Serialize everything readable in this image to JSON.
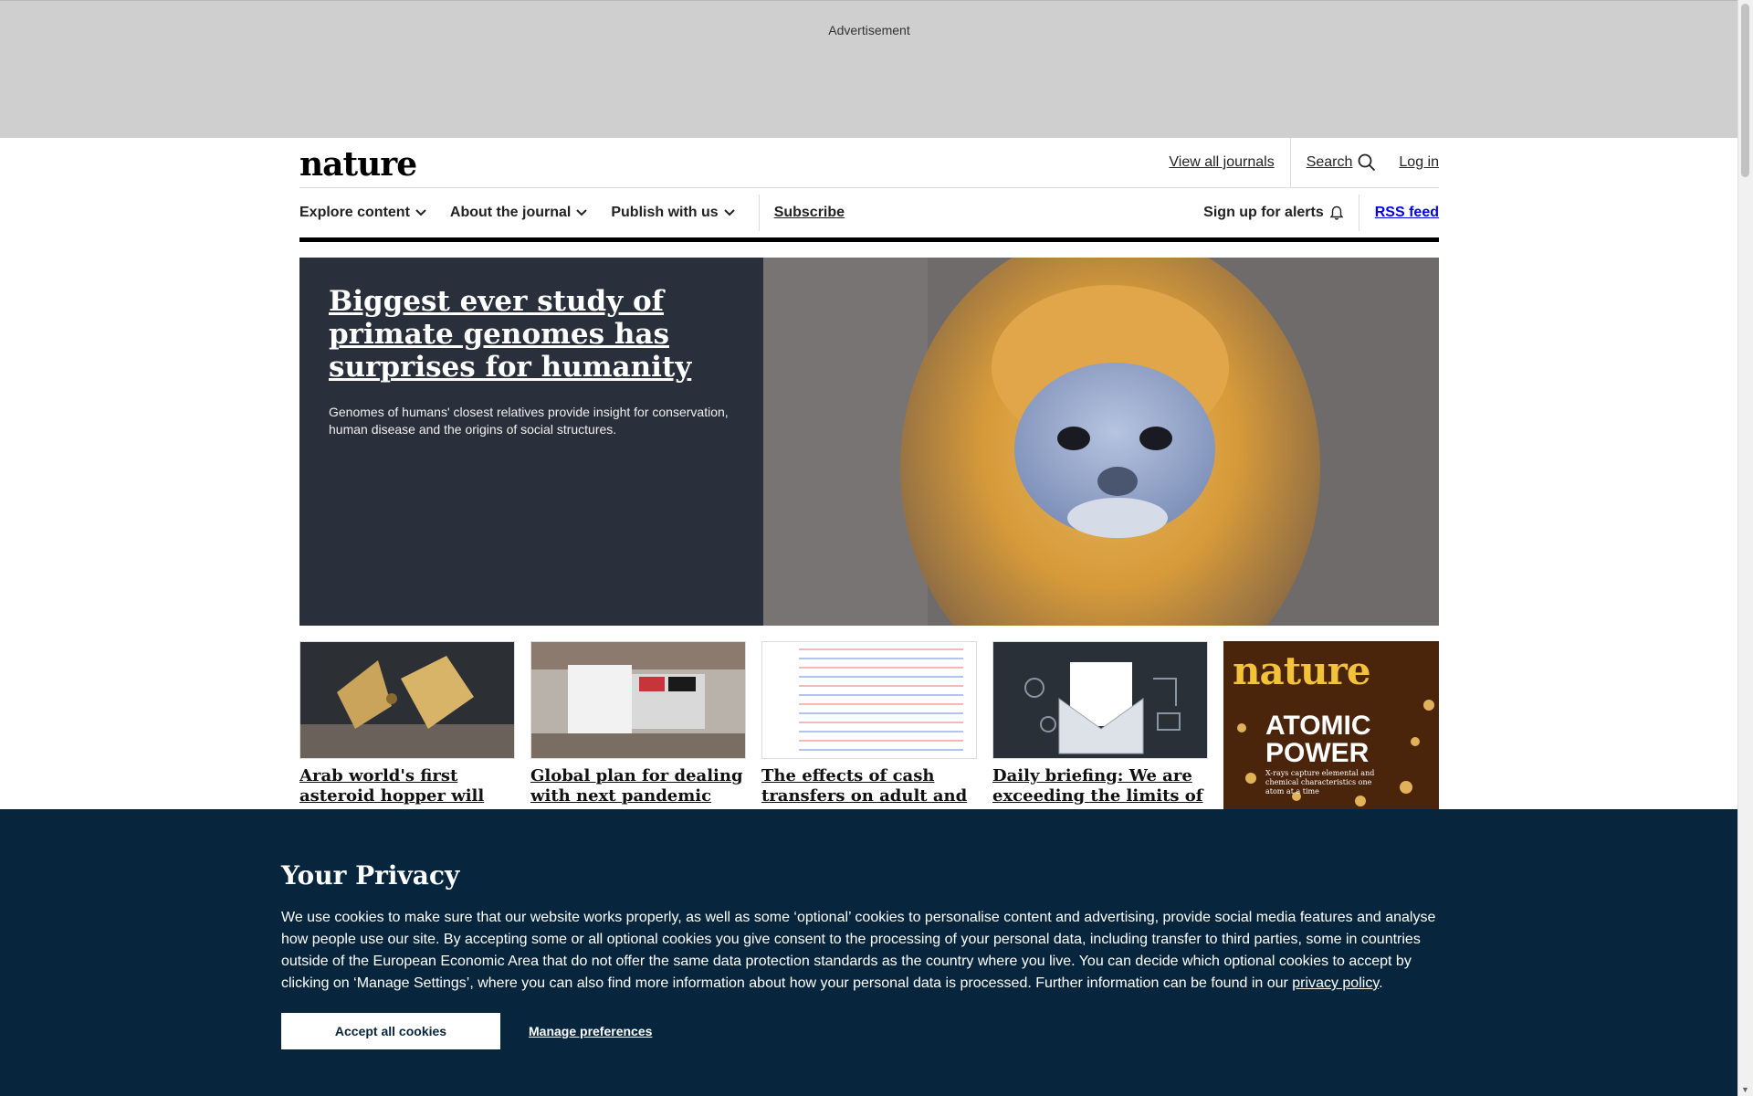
{
  "ad": {
    "label": "Advertisement"
  },
  "header": {
    "logo": "nature",
    "view_all_journals": "View all journals",
    "search": "Search",
    "login": "Log in"
  },
  "nav": {
    "items": [
      {
        "label": "Explore content"
      },
      {
        "label": "About the journal"
      },
      {
        "label": "Publish with us"
      }
    ],
    "subscribe": "Subscribe",
    "alerts": "Sign up for alerts",
    "rss": "RSS feed"
  },
  "hero": {
    "title": "Biggest ever study of primate genomes has surprises for humanity",
    "summary": "Genomes of humans' closest relatives provide insight for conservation, human disease and the origins of social structures."
  },
  "cards": [
    {
      "title": "Arab world's first asteroid hopper will visit"
    },
    {
      "title": "Global plan for dealing with next pandemic just"
    },
    {
      "title": "The effects of cash transfers on adult and"
    },
    {
      "title": "Daily briefing: We are exceeding the limits of"
    }
  ],
  "cover": {
    "masthead": "nature",
    "headline_line1": "ATOMIC",
    "headline_line2": "POWER",
    "tagline": "X-rays capture elemental and chemical characteristics one atom at a time"
  },
  "privacy": {
    "heading": "Your Privacy",
    "body": "We use cookies to make sure that our website works properly, as well as some ‘optional’ cookies to personalise content and advertising, provide social media features and analyse how people use our site. By accepting some or all optional cookies you give consent to the processing of your personal data, including transfer to third parties, some in countries outside of the European Economic Area that do not offer the same data protection standards as the country where you live. You can decide which optional cookies to accept by clicking on ‘Manage Settings’, where you can also find more information about how your personal data is processed. Further information can be found in our ",
    "policy_link": "privacy policy",
    "accept": "Accept all cookies",
    "manage": "Manage preferences"
  }
}
